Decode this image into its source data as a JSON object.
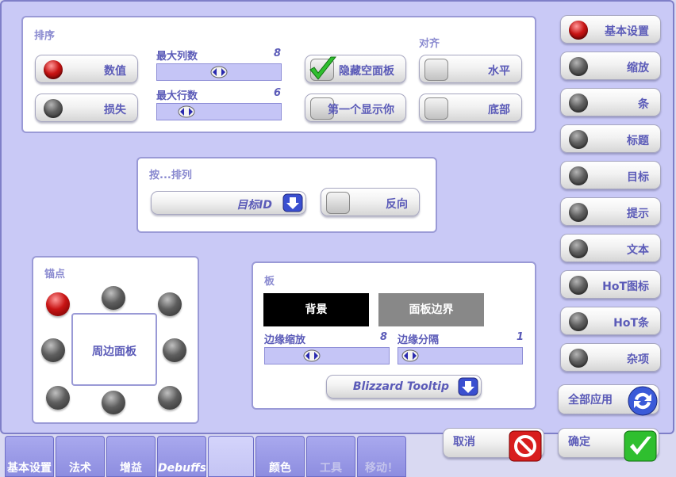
{
  "sort": {
    "title": "排序",
    "btn_value": "数值",
    "btn_missing": "损失",
    "max_cols_label": "最大列数",
    "max_cols_value": "8",
    "max_rows_label": "最大行数",
    "max_rows_value": "6",
    "hide_empty": "隐藏空面板",
    "first_shown": "第一个显示你",
    "align_title": "对齐",
    "align_h": "水平",
    "align_bottom": "底部"
  },
  "order": {
    "title": "按...排列",
    "dropdown_value": "目标ID",
    "reverse": "反向"
  },
  "anchor": {
    "title": "锚点",
    "center": "周边面板"
  },
  "board": {
    "title": "板",
    "background": "背景",
    "border": "面板边界",
    "edge_scale_label": "边缘缩放",
    "edge_scale_value": "8",
    "edge_gap_label": "边缘分隔",
    "edge_gap_value": "1",
    "tooltip_value": "Blizzard Tooltip"
  },
  "side": {
    "items": [
      "基本设置",
      "缩放",
      "条",
      "标题",
      "目标",
      "提示",
      "文本",
      "HoT图标",
      "HoT条",
      "杂项"
    ],
    "apply_all": "全部应用"
  },
  "actions": {
    "cancel": "取消",
    "ok": "确定"
  },
  "tabs": [
    "基本设置",
    "法术",
    "增益",
    "Debuffs",
    "",
    "颜色",
    "工具",
    "移动！"
  ],
  "colors": {
    "accent": "#5b5bb8",
    "frame": "#c9c9f6",
    "panel": "#ffffff"
  }
}
